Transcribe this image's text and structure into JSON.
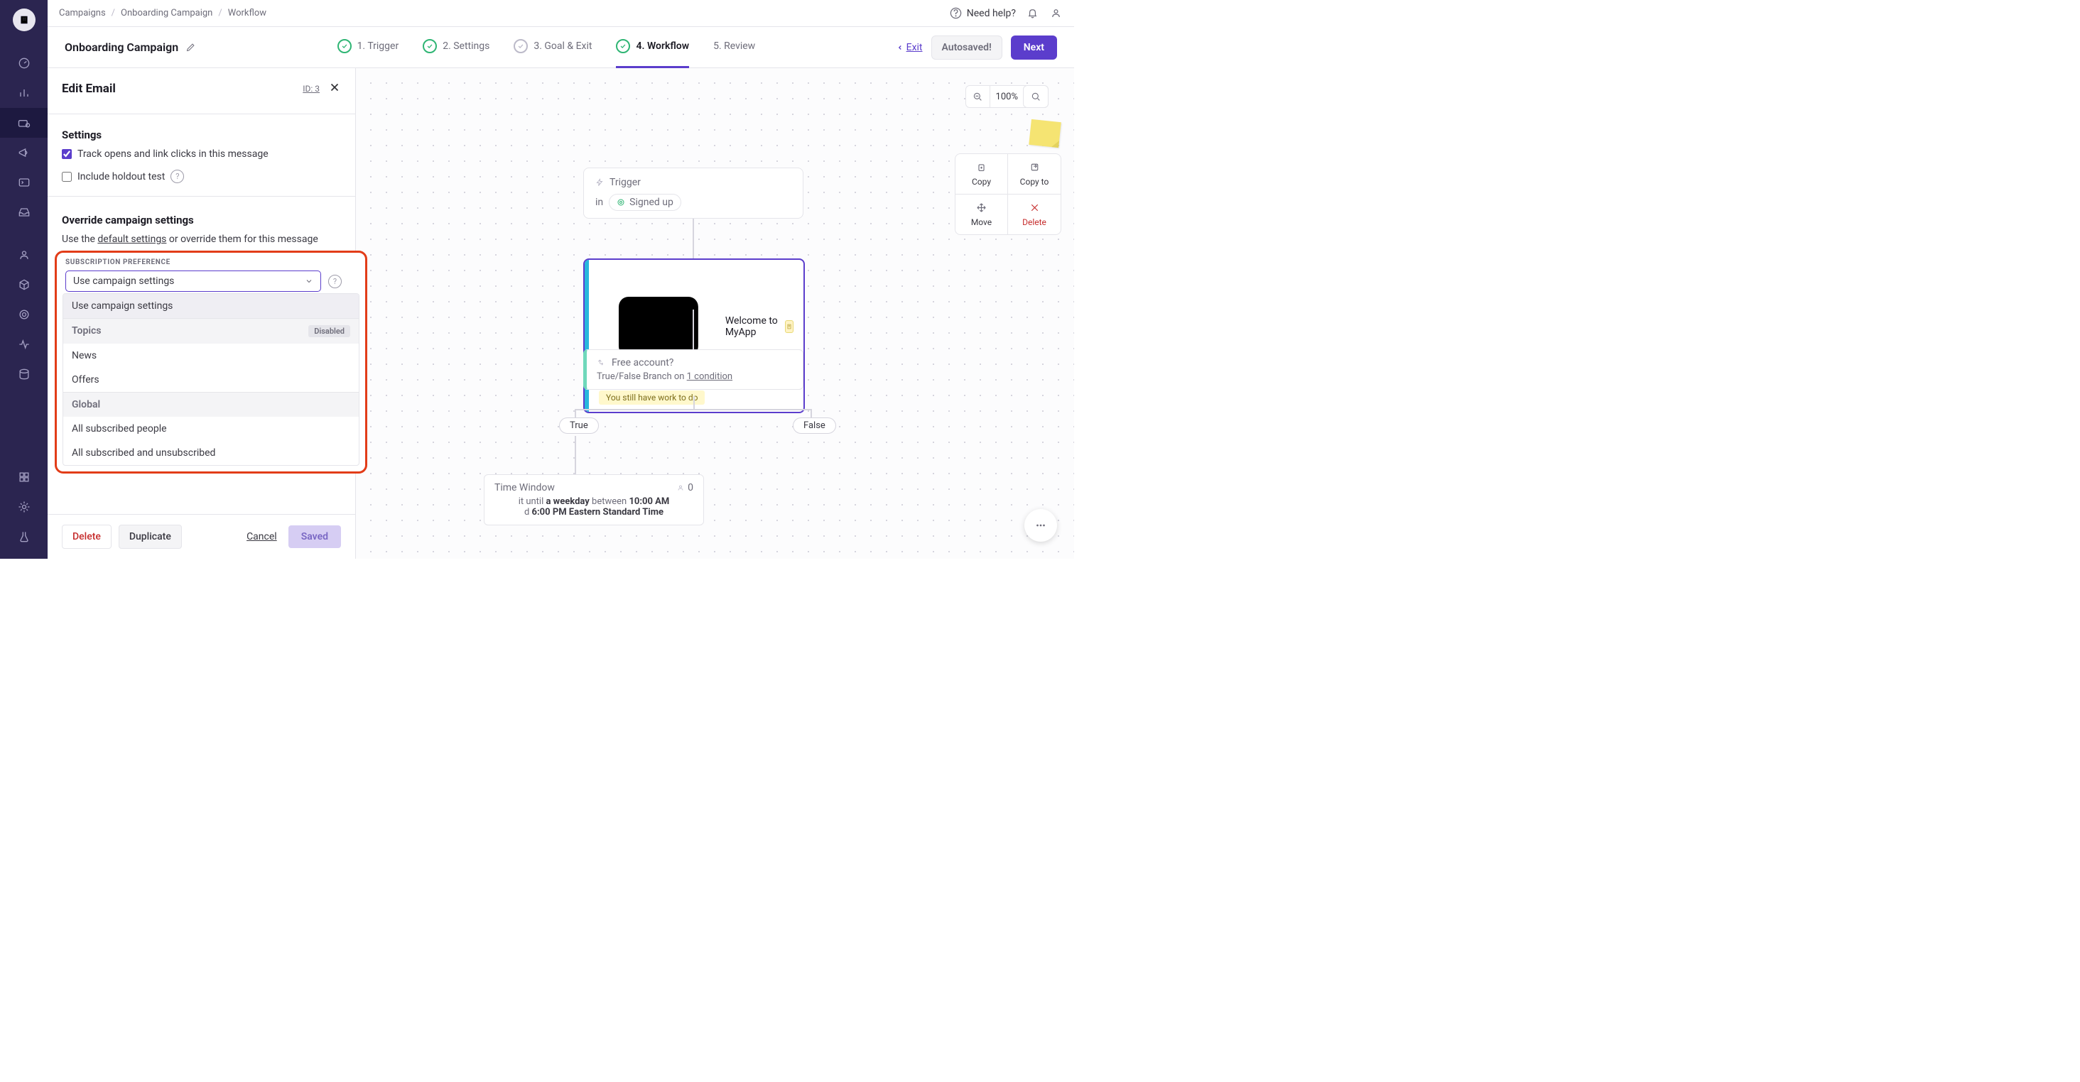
{
  "breadcrumbs": [
    "Campaigns",
    "Onboarding Campaign",
    "Workflow"
  ],
  "help_text": "Need help?",
  "campaign_name": "Onboarding Campaign",
  "steps": {
    "s1": "1. Trigger",
    "s2": "2. Settings",
    "s3": "3. Goal & Exit",
    "s4": "4. Workflow",
    "s5": "5. Review"
  },
  "exit": "Exit",
  "autosaved": "Autosaved!",
  "next": "Next",
  "sidepanel": {
    "title": "Edit Email",
    "id_label": "ID: 3",
    "settings_label": "Settings",
    "track_label": "Track opens and link clicks in this message",
    "holdout_label": "Include holdout test",
    "override_title": "Override campaign settings",
    "override_desc_pre": "Use the ",
    "override_desc_link": "default settings",
    "override_desc_post": " or override them for this message",
    "subpref_label": "SUBSCRIPTION PREFERENCE",
    "select_value": "Use campaign settings",
    "options": {
      "o1": "Use campaign settings",
      "g_topics": "Topics",
      "g_topics_dis": "Disabled",
      "o2": "News",
      "o3": "Offers",
      "g_global": "Global",
      "o4": "All subscribed people",
      "o5": "All subscribed and unsubscribed"
    },
    "footer": {
      "delete": "Delete",
      "duplicate": "Duplicate",
      "cancel": "Cancel",
      "saved": "Saved"
    }
  },
  "canvas": {
    "zoom": "100%",
    "actions": {
      "copy": "Copy",
      "copyto": "Copy to",
      "move": "Move",
      "delete": "Delete"
    },
    "trigger_label": "Trigger",
    "trigger_in": "in",
    "trigger_seg": "Signed up",
    "email_title": "Welcome to MyApp",
    "email_note": "You still have work to do",
    "branch_q": "Free account?",
    "branch_cond_pre": "True/False Branch on ",
    "branch_cond_link": "1 condition",
    "true": "True",
    "false": "False",
    "window_title": "Time Window",
    "window_people": "0",
    "window_l1_pre": "it until ",
    "window_l1_b": "a weekday",
    "window_l1_mid": " between ",
    "window_l1_t1": "10:00 AM",
    "window_l2_pre": "d ",
    "window_l2_b": "6:00 PM Eastern Standard Time"
  }
}
